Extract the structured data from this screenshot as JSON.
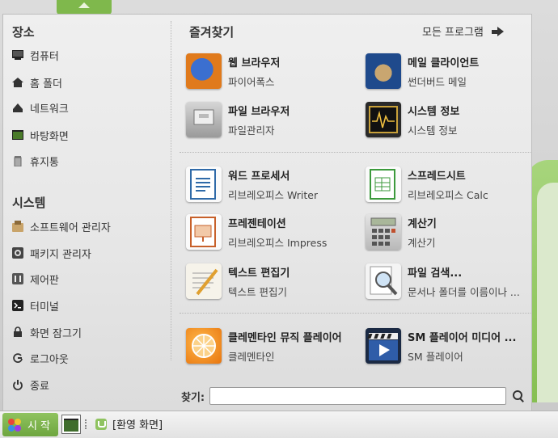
{
  "places": {
    "title": "장소",
    "items": [
      {
        "label": "컴퓨터",
        "icon": "computer-icon"
      },
      {
        "label": "홈 폴더",
        "icon": "home-folder-icon"
      },
      {
        "label": "네트워크",
        "icon": "network-icon"
      },
      {
        "label": "바탕화면",
        "icon": "desktop-icon"
      },
      {
        "label": "휴지통",
        "icon": "trash-icon"
      }
    ]
  },
  "system": {
    "title": "시스템",
    "items": [
      {
        "label": "소프트웨어 관리자",
        "icon": "software-manager-icon"
      },
      {
        "label": "패키지 관리자",
        "icon": "package-manager-icon"
      },
      {
        "label": "제어판",
        "icon": "control-panel-icon"
      },
      {
        "label": "터미널",
        "icon": "terminal-icon"
      },
      {
        "label": "화면 잠그기",
        "icon": "lock-icon"
      },
      {
        "label": "로그아웃",
        "icon": "logout-icon"
      },
      {
        "label": "종료",
        "icon": "power-icon"
      }
    ]
  },
  "favorites": {
    "title": "즐겨찾기",
    "all_programs": "모든 프로그램",
    "apps": [
      {
        "name": "웹 브라우저",
        "desc": "파이어폭스",
        "icon": "firefox-icon"
      },
      {
        "name": "메일 클라이언트",
        "desc": "썬더버드 메일",
        "icon": "thunderbird-icon"
      },
      {
        "name": "파일 브라우저",
        "desc": "파일관리자",
        "icon": "file-manager-icon"
      },
      {
        "name": "시스템 정보",
        "desc": "시스템 정보",
        "icon": "system-monitor-icon"
      },
      {
        "name": "워드 프로세서",
        "desc": "리브레오피스 Writer",
        "icon": "libreoffice-writer-icon"
      },
      {
        "name": "스프레드시트",
        "desc": "리브레오피스 Calc",
        "icon": "libreoffice-calc-icon"
      },
      {
        "name": "프레젠테이션",
        "desc": "리브레오피스 Impress",
        "icon": "libreoffice-impress-icon"
      },
      {
        "name": "계산기",
        "desc": "계산기",
        "icon": "calculator-icon"
      },
      {
        "name": "텍스트 편집기",
        "desc": "텍스트 편집기",
        "icon": "text-editor-icon"
      },
      {
        "name": "파일 검색...",
        "desc": "문서나 폴더를 이름이나 ...",
        "icon": "file-search-icon"
      },
      {
        "name": "클레멘타인 뮤직 플레이어",
        "desc": "클레멘타인",
        "icon": "clementine-icon"
      },
      {
        "name": "SM 플레이어 미디어 ...",
        "desc": "SM 플레이어",
        "icon": "smplayer-icon"
      }
    ]
  },
  "search": {
    "label": "찾기:",
    "value": ""
  },
  "taskbar": {
    "start_label": "시 작",
    "window_label": "[환영 화면]"
  }
}
